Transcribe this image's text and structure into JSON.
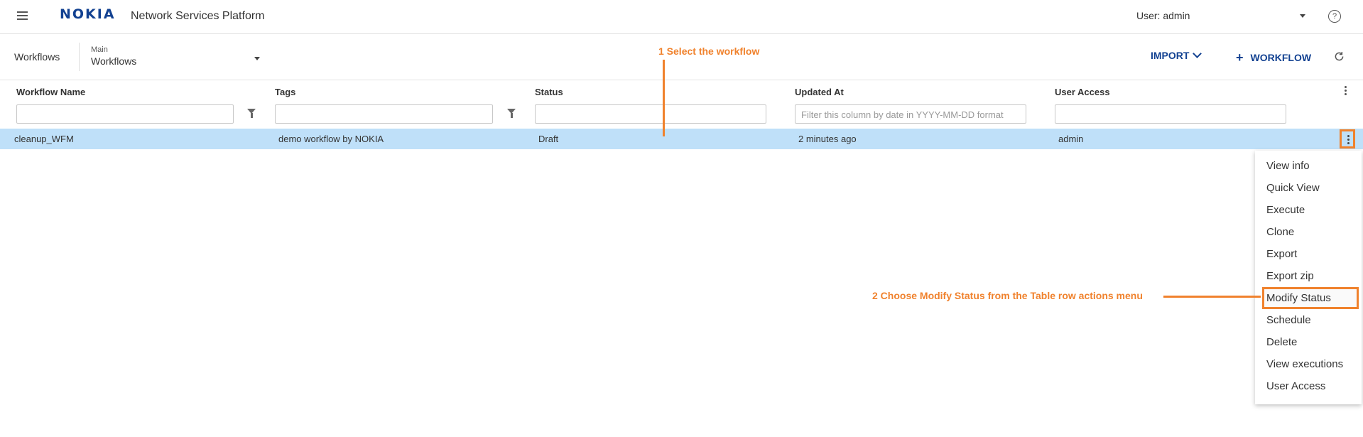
{
  "header": {
    "logo": "NOKIA",
    "app_title": "Network Services Platform",
    "user_label": "User: admin",
    "help_symbol": "?"
  },
  "subheader": {
    "breadcrumb": "Workflows",
    "selector_label": "Main",
    "selector_value": "Workflows",
    "import_label": "IMPORT",
    "add_workflow_label": "WORKFLOW"
  },
  "table": {
    "columns": [
      "Workflow Name",
      "Tags",
      "Status",
      "Updated At",
      "User Access"
    ],
    "filters": {
      "updated_at_placeholder": "Filter this column by date in YYYY-MM-DD format"
    },
    "rows": [
      {
        "name": "cleanup_WFM",
        "tags": "demo workflow by NOKIA",
        "status": "Draft",
        "updated_at": "2 minutes ago",
        "user_access": "admin"
      }
    ]
  },
  "row_actions_menu": {
    "items": [
      "View info",
      "Quick View",
      "Execute",
      "Clone",
      "Export",
      "Export zip",
      "Modify Status",
      "Schedule",
      "Delete",
      "View executions",
      "User Access"
    ],
    "highlighted": "Modify Status"
  },
  "annotations": {
    "step1": "1 Select the workflow",
    "step2": "2 Choose Modify Status from the Table row actions menu"
  },
  "colors": {
    "brand": "#124191",
    "selected_row": "#bfe0f9",
    "annotation": "#f0822d"
  },
  "icons": [
    "hamburger-icon",
    "help-icon",
    "chevron-down-icon",
    "plus-icon",
    "refresh-icon",
    "filter-icon",
    "kebab-menu-icon"
  ]
}
